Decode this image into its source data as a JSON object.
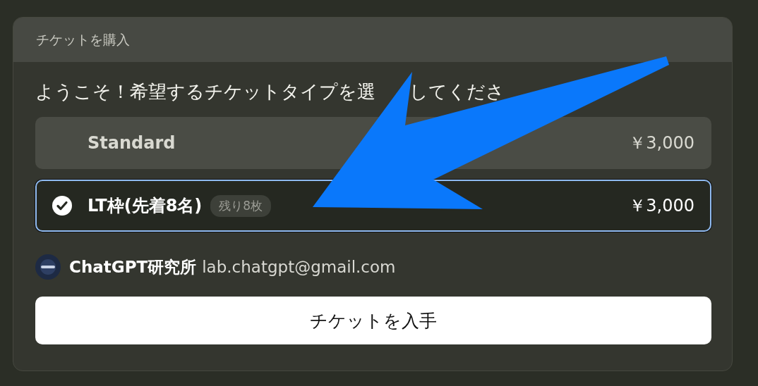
{
  "dialog": {
    "title": "チケットを購入"
  },
  "intro": [
    "ようこそ！希望するチケットタイプを選",
    "してくださ"
  ],
  "tickets": [
    {
      "name": "Standard",
      "price": "￥3,000",
      "selected": false
    },
    {
      "name": "LT枠(先着8名)",
      "badge": "残り8枚",
      "price": "￥3,000",
      "selected": true
    }
  ],
  "organizer": {
    "name": "ChatGPT研究所",
    "email": "lab.chatgpt@gmail.com"
  },
  "button": "チケットを入手",
  "annotation": {
    "kind": "arrow"
  }
}
